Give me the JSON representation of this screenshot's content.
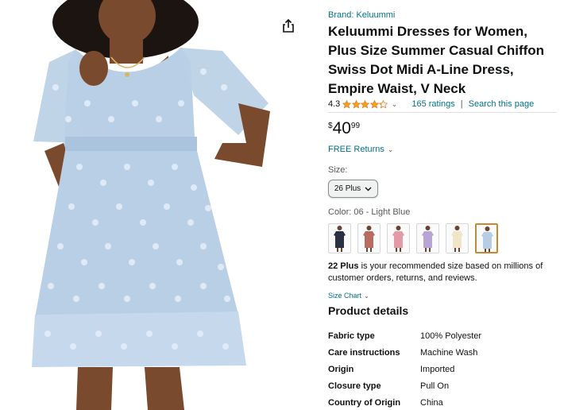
{
  "product": {
    "brand": "Brand: Keluummi",
    "title": "Keluummi Dresses for Women, Plus Size Summer Casual Chiffon Swiss Dot Midi A-Line Dress, Empire Waist, V Neck",
    "rating": "4.3",
    "rating_value": 4.3,
    "ratings_count": "165 ratings",
    "separator": "|",
    "search_link": "Search this page",
    "price_symbol": "$",
    "price_whole": "40",
    "price_fraction": "99",
    "returns": "FREE Returns",
    "size_label": "Size:",
    "size_selected": "26 Plus",
    "color_label": "Color: 06 - Light Blue",
    "swatches": [
      {
        "name": "navy",
        "color": "#2a3044"
      },
      {
        "name": "rust",
        "color": "#b86b5e"
      },
      {
        "name": "pink",
        "color": "#e29aa6"
      },
      {
        "name": "lavender",
        "color": "#b9a4d6"
      },
      {
        "name": "cream",
        "color": "#efe5c8"
      },
      {
        "name": "light-blue",
        "color": "#b6cde4"
      }
    ],
    "recommend_bold": "22 Plus",
    "recommend_text": " is your recommended size based on millions of customer orders, returns, and reviews.",
    "size_chart": "Size Chart",
    "details_heading": "Product details",
    "specs": [
      {
        "key": "Fabric type",
        "value": "100% Polyester"
      },
      {
        "key": "Care instructions",
        "value": "Machine Wash"
      },
      {
        "key": "Origin",
        "value": "Imported"
      },
      {
        "key": "Closure type",
        "value": "Pull On"
      },
      {
        "key": "Country of Origin",
        "value": "China"
      }
    ]
  },
  "colors": {
    "link": "#007185",
    "star": "#f4a41d",
    "selected_border": "#c7892f",
    "dress": "#b9cfe5"
  },
  "icons": {
    "share": "share-icon",
    "star": "star-icon",
    "chevron": "chevron-down-icon"
  }
}
